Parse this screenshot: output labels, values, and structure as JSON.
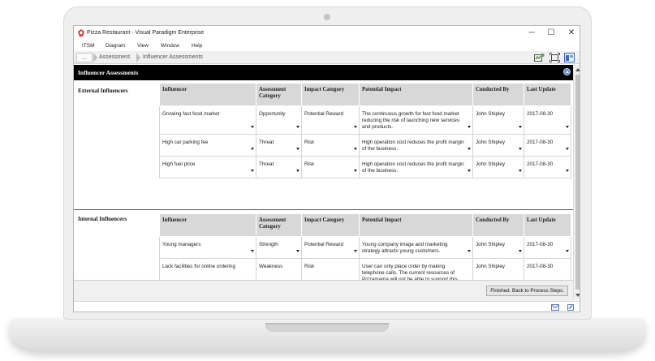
{
  "window": {
    "title": "Pizza Restaurant - Visual Paradigm Enterprise",
    "minimize": "─",
    "maximize": "☐",
    "close": "✕"
  },
  "menu": [
    "ITSM",
    "Diagram",
    "View",
    "Window",
    "Help"
  ],
  "breadcrumb": [
    "...",
    "Assessment",
    "Influencer Assessments"
  ],
  "page": {
    "title": "Influencer Assessments",
    "finish_button": "Finished. Back to Process Steps."
  },
  "columns": [
    "Influencer",
    "Assessment Category",
    "Impact Category",
    "Potential Impact",
    "Conducted By",
    "Last Update"
  ],
  "sections": [
    {
      "label": "External Influencers",
      "rows": [
        {
          "influencer": "Growing fast food market",
          "assessment_category": "Opportunity",
          "impact_category": "Potential Reward",
          "potential_impact": "The continuous growth for fast food market reducing the risk of launching new services and products.",
          "conducted_by": "John Shipley",
          "last_update": "2017-08-30"
        },
        {
          "influencer": "High car parking fee",
          "assessment_category": "Threat",
          "impact_category": "Risk",
          "potential_impact": "High operation cost reduces the profit margin of the business.",
          "conducted_by": "John Shipley",
          "last_update": "2017-08-30"
        },
        {
          "influencer": "High fuel price",
          "assessment_category": "Threat",
          "impact_category": "Risk",
          "potential_impact": "High operation cost reduces the profit margin of the business.",
          "conducted_by": "John Shipley",
          "last_update": "2017-08-30"
        }
      ]
    },
    {
      "label": "Internal Influencers",
      "rows": [
        {
          "influencer": "Young managers",
          "assessment_category": "Strength",
          "impact_category": "Potential Reward",
          "potential_impact": "Young company image and marketing strategy attracts young customers.",
          "conducted_by": "John Shipley",
          "last_update": "2017-08-30"
        },
        {
          "influencer": "Lack facilities for online ordering",
          "assessment_category": "Weakness",
          "impact_category": "Risk",
          "potential_impact": "User can only place order by making telephone calls. The current resources of Pizzamama will not be able to support this arrangement. It is vital to revamp the corporate website by including facilitates for ordering.",
          "conducted_by": "John Shipley",
          "last_update": "2017-08-30"
        }
      ]
    }
  ],
  "colors": {
    "header_band": "#000000",
    "table_header": "#d8d8d8",
    "accent": "#5b8bd6"
  }
}
